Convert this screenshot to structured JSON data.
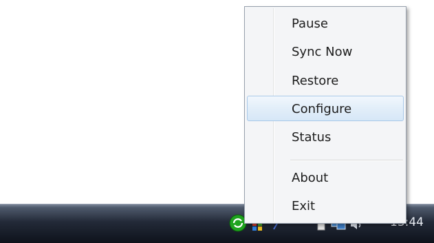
{
  "menu": {
    "items": [
      {
        "label": "Pause"
      },
      {
        "label": "Sync Now"
      },
      {
        "label": "Restore"
      },
      {
        "label": "Configure",
        "highlighted": true
      },
      {
        "label": "Status"
      },
      {
        "label": "About"
      },
      {
        "label": "Exit"
      }
    ]
  },
  "taskbar": {
    "clock": "13:44",
    "tray_icons": [
      "sync-app-icon",
      "windows-flag-icon",
      "arrow-icon",
      "clipboard-icon",
      "network-icon",
      "volume-icon"
    ]
  },
  "colors": {
    "highlight_bg": "#d6e7f7",
    "highlight_border": "#a8c8e8",
    "taskbar": "#1a202c",
    "sync_icon_green": "#1fa31f"
  }
}
